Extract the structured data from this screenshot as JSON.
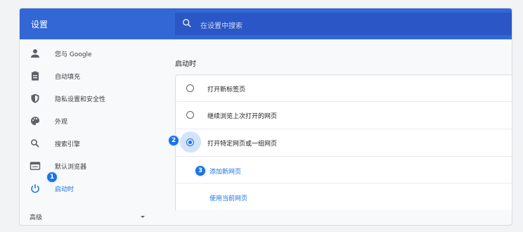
{
  "header": {
    "title": "设置",
    "search_placeholder": "在设置中搜索"
  },
  "sidebar": {
    "items": [
      {
        "label": "您与 Google",
        "icon": "person-icon"
      },
      {
        "label": "自动填充",
        "icon": "clipboard-icon"
      },
      {
        "label": "隐私设置和安全性",
        "icon": "shield-icon"
      },
      {
        "label": "外观",
        "icon": "palette-icon"
      },
      {
        "label": "搜索引擎",
        "icon": "search-icon"
      },
      {
        "label": "默认浏览器",
        "icon": "browser-icon"
      },
      {
        "label": "启动时",
        "icon": "power-icon"
      }
    ],
    "advanced_label": "高级",
    "active_index": 6
  },
  "main": {
    "section_title": "启动时",
    "options": [
      {
        "label": "打开新标签页",
        "selected": false
      },
      {
        "label": "继续浏览上次打开的网页",
        "selected": false
      },
      {
        "label": "打开特定网页或一组网页",
        "selected": true
      }
    ],
    "add_page_label": "添加新网页",
    "use_current_label": "使用当前网页"
  },
  "badges": [
    "1",
    "2",
    "3"
  ],
  "colors": {
    "accent": "#1a73e8",
    "header": "#3367d6"
  }
}
